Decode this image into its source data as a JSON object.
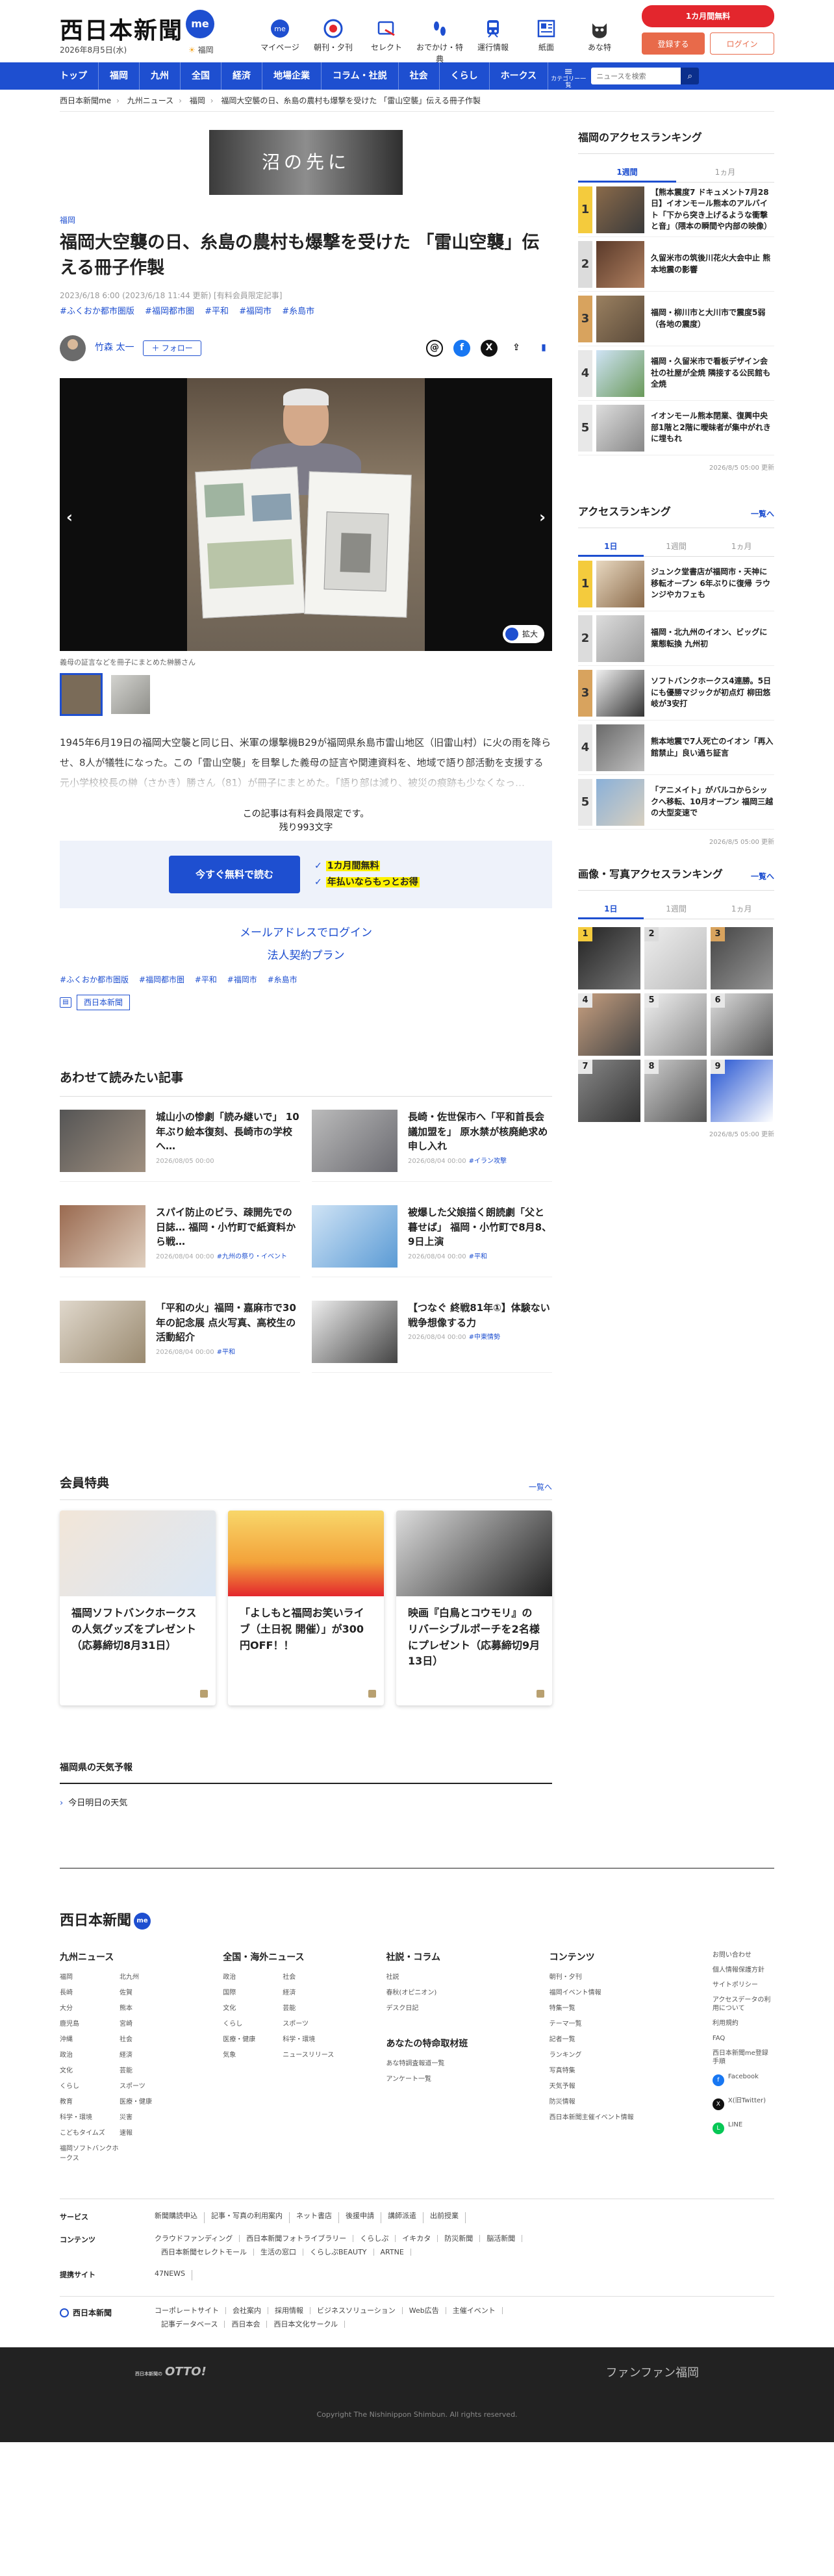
{
  "header": {
    "logo": "西日本新聞",
    "logo_badge": "me",
    "date": "2026年8月5日(水)",
    "weather_city": "福岡",
    "nav": [
      {
        "label": "マイページ",
        "icon": "me-icon"
      },
      {
        "label": "朝刊・夕刊",
        "icon": "newspaper-icon"
      },
      {
        "label": "セレクト",
        "icon": "select-icon"
      },
      {
        "label": "おでかけ・特典",
        "icon": "footprint-icon"
      },
      {
        "label": "運行情報",
        "icon": "train-icon"
      },
      {
        "label": "紙面",
        "icon": "paper-icon"
      },
      {
        "label": "あな特",
        "icon": "cat-icon"
      }
    ],
    "promo": "1カ月間無料",
    "register": "登録する",
    "login": "ログイン"
  },
  "main_nav": {
    "items": [
      "トップ",
      "福岡",
      "九州",
      "全国",
      "経済",
      "地場企業",
      "コラム・社説",
      "社会",
      "くらし",
      "ホークス"
    ],
    "menu_label": "カテゴリー一覧",
    "search_placeholder": "ニュースを検索"
  },
  "breadcrumb": [
    "西日本新聞me",
    "九州ニュース",
    "福岡",
    "福岡大空襲の日、糸島の農村も爆撃を受けた 「雷山空襲」伝える冊子作製"
  ],
  "article": {
    "banner_text": "沼の先に",
    "category": "福岡",
    "title": "福岡大空襲の日、糸島の農村も爆撃を受けた 「雷山空襲」伝える冊子作製",
    "meta": "2023/6/18 6:00 (2023/6/18 11:44 更新) [有料会員限定記事]",
    "tags": [
      "#ふくおか都市圏版",
      "#福岡都市圏",
      "#平和",
      "#福岡市",
      "#糸島市"
    ],
    "author": "竹森 太一",
    "follow": "＋ フォロー",
    "zoom": "拡大",
    "caption": "義母の証言などを冊子にまとめた榊勝さん",
    "body": "1945年6月19日の福岡大空襲と同じ日、米軍の爆撃機B29が福岡県糸島市雷山地区（旧雷山村）に火の雨を降らせ、8人が犠牲になった。この「雷山空襲」を目撃した義母の証言や関連資料を、地域で語り部活動を支援する元小学校校長の榊（さかき）勝さん（81）が冊子にまとめた。「語り部は減り、被災の痕跡も少なくなっ…",
    "paywall_1": "この記事は有料会員限定です。",
    "paywall_2": "残り993文字",
    "cta": "今すぐ無料で読む",
    "perk_1": "1カ月間無料",
    "perk_2": "年払いならもっとお得",
    "login_link": "メールアドレスでログイン",
    "corp_link": "法人契約プラン",
    "publisher": "西日本新聞"
  },
  "related": {
    "title": "あわせて読みたい記事",
    "items": [
      {
        "title": "城山小の惨劇「読み継いで」 10年ぶり絵本復刻、長崎市の学校へ…",
        "date": "2026/08/05 00:00",
        "tag": ""
      },
      {
        "title": "長崎・佐世保市へ「平和首長会議加盟を」 原水禁が核廃絶求め申し入れ",
        "date": "2026/08/04 00:00",
        "tag": "#イラン攻撃"
      },
      {
        "title": "スパイ防止のビラ、疎開先での日誌… 福岡・小竹町で紙資料から戦…",
        "date": "2026/08/04 00:00",
        "tag": "#九州の祭り・イベント"
      },
      {
        "title": "被爆した父娘描く朗読劇「父と暮せば」 福岡・小竹町で8月8、9日上演",
        "date": "2026/08/04 00:00",
        "tag": "#平和"
      },
      {
        "title": "「平和の火」福岡・嘉麻市で30年の記念展 点火写真、高校生の活動紹介",
        "date": "2026/08/04 00:00",
        "tag": "#平和"
      },
      {
        "title": "【つなぐ 終戦81年①】体験ない戦争想像する力",
        "date": "2026/08/04 00:00",
        "tag": "#中東情勢"
      }
    ]
  },
  "perks": {
    "title": "会員特典",
    "more": "一覧へ",
    "items": [
      "福岡ソフトバンクホークスの人気グッズをプレゼント（応募締切8月31日）",
      "「よしもと福岡お笑いライブ（土日祝 開催）」が300円OFF！！",
      "映画『白鳥とコウモリ』のリバーシブルポーチを2名様にプレゼント（応募締切9月13日）"
    ]
  },
  "weather": {
    "title": "福岡県の天気予報",
    "item": "今日明日の天気"
  },
  "sidebar": {
    "ranking1": {
      "title": "福岡のアクセスランキング",
      "tabs": [
        "1週間",
        "1ヵ月"
      ],
      "items": [
        "【熊本震度7 ドキュメント7月28日】イオンモール熊本のアルバイト「下から突き上げるような衝撃と音」（隈本の瞬間や内部の映像）",
        "久留米市の筑後川花火大会中止 熊本地震の影響",
        "福岡・柳川市と大川市で震度5弱（各地の震度）",
        "福岡・久留米市で看板デザイン会社の社屋が全焼 隣接する公民館も全焼",
        "イオンモール熊本閉業、復興中央部1階と2階に曖昧者が集中がれきに埋もれ"
      ],
      "note": "2026/8/5 05:00 更新"
    },
    "ranking2": {
      "title": "アクセスランキング",
      "more": "一覧へ",
      "tabs": [
        "1日",
        "1週間",
        "1ヵ月"
      ],
      "items": [
        "ジュンク堂書店が福岡市・天神に移転オープン 6年ぶりに復帰 ラウンジやカフェも",
        "福岡・北九州のイオン、ビッグに業態転換 九州初",
        "ソフトバンクホークス4連勝。5日にも優勝マジックが初点灯 柳田悠岐が3安打",
        "熊本地震で7人死亡のイオン「再入館禁止」良い過ち証言",
        "「アニメイト」がバルコからシックへ移転、10月オープン 福岡三越の大型変速で"
      ],
      "note": "2026/8/5 05:00 更新"
    },
    "photo_ranking": {
      "title": "画像・写真アクセスランキング",
      "more": "一覧へ",
      "tabs": [
        "1日",
        "1週間",
        "1ヵ月"
      ],
      "numbers": [
        "1",
        "2",
        "3",
        "4",
        "5",
        "6",
        "7",
        "8",
        "9"
      ],
      "note": "2026/8/5 05:00 更新"
    }
  },
  "footer": {
    "logo": "西日本新聞",
    "logo_badge": "me",
    "col1": {
      "title": "九州ニュース",
      "items": [
        "福岡",
        "北九州",
        "長崎",
        "佐賀",
        "大分",
        "熊本",
        "鹿児島",
        "宮崎",
        "沖縄",
        "社会",
        "政治",
        "経済",
        "文化",
        "芸能",
        "くらし",
        "スポーツ",
        "教育",
        "医療・健康",
        "科学・環境",
        "災害",
        "こどもタイムズ",
        "速報",
        "福岡ソフトバンクホークス"
      ]
    },
    "col2": {
      "title": "全国・海外ニュース",
      "items": [
        "政治",
        "社会",
        "国際",
        "経済",
        "文化",
        "芸能",
        "くらし",
        "スポーツ",
        "医療・健康",
        "科学・環境",
        "気象",
        "ニュースリリース"
      ]
    },
    "col3": {
      "title": "社説・コラム",
      "items": [
        "社説",
        "春秋(オピニオン)",
        "デスク日記"
      ],
      "sub_title": "あなたの特命取材班",
      "sub_items": [
        "あな特調査報道一覧",
        "アンケート一覧"
      ]
    },
    "col4": {
      "title": "コンテンツ",
      "items": [
        "朝刊・夕刊",
        "福岡イベント情報",
        "特集一覧",
        "テーマ一覧",
        "記者一覧",
        "ランキング",
        "写真特集",
        "天気予報",
        "防災情報",
        "西日本新聞主催イベント情報"
      ]
    },
    "col5": [
      "お問い合わせ",
      "個人情報保護方針",
      "サイトポリシー",
      "アクセスデータの利用について",
      "利用規約",
      "FAQ",
      "西日本新聞me登録手順"
    ],
    "sns": [
      "Facebook",
      "X(旧Twitter)",
      "LINE"
    ],
    "services_label": "サービス",
    "services": [
      "新聞購読申込",
      "記事・写真の利用案内",
      "ネット書店",
      "後援申請",
      "講師派遣",
      "出前授業"
    ],
    "contents_label": "コンテンツ",
    "contents": [
      "クラウドファンディング",
      "西日本新聞フォトライブラリー",
      "くらしぷ",
      "イキカタ",
      "防災新聞",
      "脳活新聞",
      "西日本新聞セレクトモール",
      "生活の窓口",
      "くらしぷBEAUTY",
      "ARTNE"
    ],
    "sites_label": "提携サイト",
    "sites": [
      "47NEWS"
    ],
    "corp_label": "西日本新聞",
    "corp": [
      "コーポレートサイト",
      "会社案内",
      "採用情報",
      "ビジネスソリューション",
      "Web広告",
      "主催イベント",
      "記事データベース",
      "西日本会",
      "西日本文化サークル"
    ],
    "bottom_left_small": "西日本新聞の",
    "bottom_left": "OTTO!",
    "bottom_right": "ファンファン福岡",
    "copyright": "Copyright The Nishinippon Shimbun. All rights reserved."
  },
  "colors": {
    "brand": "#1e4fd0",
    "accent": "#e3262d",
    "highlight": "#fff200"
  }
}
